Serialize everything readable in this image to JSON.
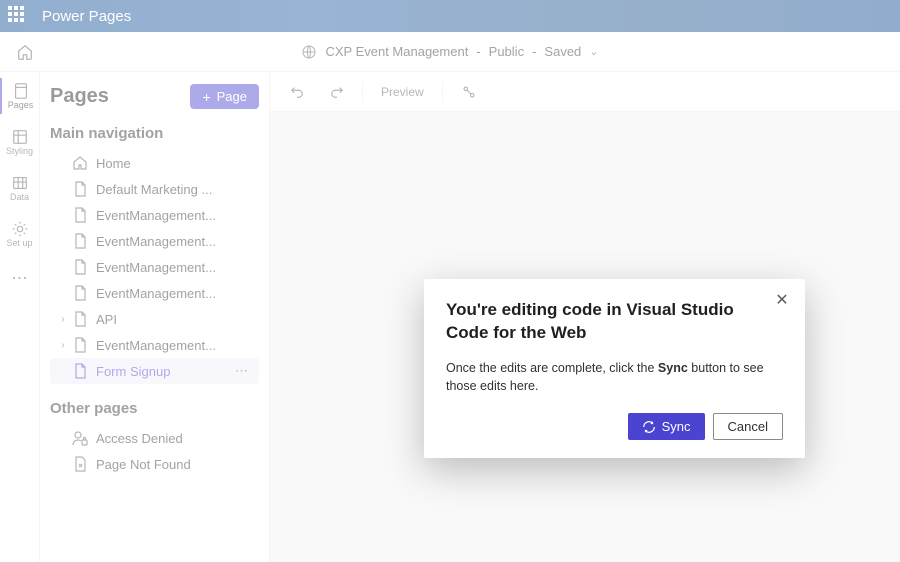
{
  "brand": {
    "title": "Power Pages"
  },
  "context": {
    "site_name": "CXP Event Management",
    "visibility": "Public",
    "save_state": "Saved"
  },
  "rail": {
    "items": [
      {
        "label": "Pages"
      },
      {
        "label": "Styling"
      },
      {
        "label": "Data"
      },
      {
        "label": "Set up"
      }
    ]
  },
  "panel": {
    "title": "Pages",
    "add_button": "Page",
    "sections": {
      "main_nav_title": "Main navigation",
      "other_pages_title": "Other pages"
    },
    "main_nav": [
      {
        "label": "Home",
        "icon": "home",
        "expandable": false
      },
      {
        "label": "Default Marketing ...",
        "icon": "page",
        "expandable": false
      },
      {
        "label": "EventManagement...",
        "icon": "page",
        "expandable": false
      },
      {
        "label": "EventManagement...",
        "icon": "page",
        "expandable": false
      },
      {
        "label": "EventManagement...",
        "icon": "page",
        "expandable": false
      },
      {
        "label": "EventManagement...",
        "icon": "page",
        "expandable": false
      },
      {
        "label": "API",
        "icon": "page",
        "expandable": true
      },
      {
        "label": "EventManagement...",
        "icon": "page",
        "expandable": true
      },
      {
        "label": "Form Signup",
        "icon": "page",
        "expandable": false,
        "selected": true
      }
    ],
    "other_pages": [
      {
        "label": "Access Denied",
        "icon": "person-lock"
      },
      {
        "label": "Page Not Found",
        "icon": "page-error"
      }
    ]
  },
  "toolbar": {
    "undo": "Undo",
    "redo": "Redo",
    "preview": "Preview",
    "code": "Code"
  },
  "dialog": {
    "title": "You're editing code in Visual Studio Code for the Web",
    "body_pre": "Once the edits are complete, click the ",
    "body_bold": "Sync",
    "body_post": " button to see those edits here.",
    "sync_label": "Sync",
    "cancel_label": "Cancel"
  }
}
